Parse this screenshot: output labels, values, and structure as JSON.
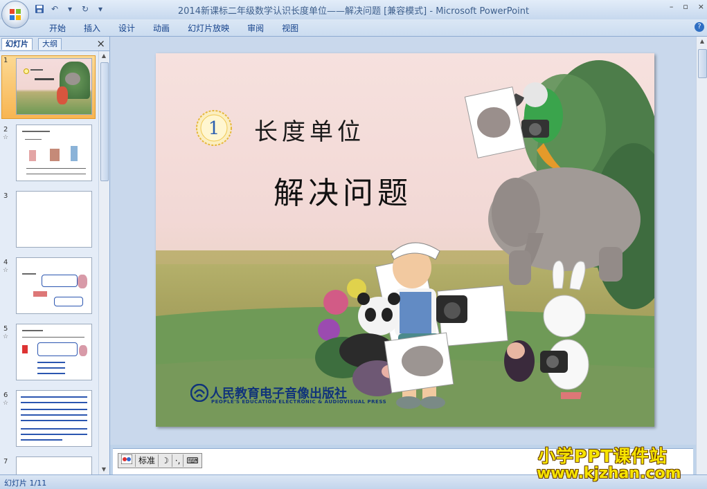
{
  "window": {
    "title": "2014新课标二年级数学认识长度单位——解决问题 [兼容模式] - Microsoft PowerPoint",
    "controls": [
      "–",
      "▫",
      "×"
    ]
  },
  "ribbon": {
    "tabs": [
      "开始",
      "插入",
      "设计",
      "动画",
      "幻灯片放映",
      "审阅",
      "视图"
    ],
    "help": "?"
  },
  "left_pane": {
    "tabs": [
      "幻灯片",
      "大纲"
    ],
    "close": "×",
    "thumbnails": [
      {
        "number": "1",
        "selected": true
      },
      {
        "number": "2",
        "star": "☆"
      },
      {
        "number": "3"
      },
      {
        "number": "4",
        "star": "☆"
      },
      {
        "number": "5",
        "star": "☆"
      },
      {
        "number": "6",
        "star": "☆"
      },
      {
        "number": "7"
      }
    ]
  },
  "slide": {
    "badge_number": "1",
    "heading": "长度单位",
    "title": "解决问题",
    "publisher_cn": "人民教育电子音像出版社",
    "publisher_en": "PEOPLE'S EDUCATION ELECTRONIC & AUDIOVISUAL PRESS"
  },
  "toolbar_bottom": {
    "input_mode": "标准"
  },
  "status": {
    "slide_counter": "幻灯片 1/11"
  },
  "watermark": {
    "line1": "小学PPT课件站",
    "line2": "www.kjzhan.com"
  },
  "colors": {
    "accent": "#15428b",
    "selection": "#f8b552",
    "watermark": "#f7e400"
  }
}
